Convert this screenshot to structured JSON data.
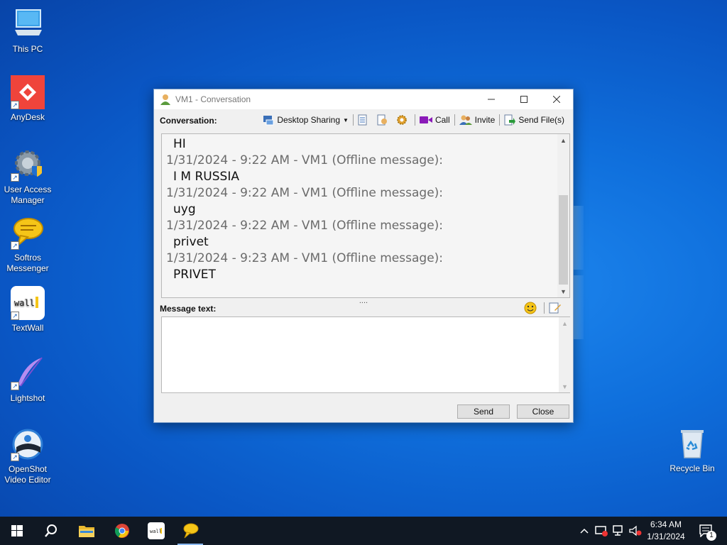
{
  "desktop": {
    "icons": [
      {
        "label": "This PC",
        "name": "this-pc-icon"
      },
      {
        "label": "AnyDesk",
        "name": "anydesk-icon"
      },
      {
        "label": "User Access Manager",
        "name": "user-access-manager-icon"
      },
      {
        "label": "Softros Messenger",
        "name": "softros-messenger-icon"
      },
      {
        "label": "TextWall",
        "name": "textwall-icon"
      },
      {
        "label": "Lightshot",
        "name": "lightshot-icon"
      },
      {
        "label": "OpenShot Video Editor",
        "name": "openshot-icon"
      },
      {
        "label": "Recycle Bin",
        "name": "recycle-bin-icon"
      }
    ]
  },
  "window": {
    "title": "VM1 - Conversation",
    "conversation_label": "Conversation:",
    "toolbar": {
      "desktop_sharing": "Desktop Sharing",
      "call": "Call",
      "invite": "Invite",
      "send_files": "Send File(s)"
    },
    "messages": [
      {
        "header": "",
        "text": "HI"
      },
      {
        "header": "1/31/2024 - 9:22 AM - VM1 (Offline message):",
        "text": "I M RUSSIA"
      },
      {
        "header": "1/31/2024 - 9:22 AM - VM1 (Offline message):",
        "text": "uyg"
      },
      {
        "header": "1/31/2024 - 9:22 AM - VM1 (Offline message):",
        "text": "privet"
      },
      {
        "header": "1/31/2024 - 9:23 AM - VM1 (Offline message):",
        "text": "PRIVET"
      }
    ],
    "splitter_grip": "....",
    "message_text_label": "Message text:",
    "message_input_value": "",
    "send_label": "Send",
    "close_label": "Close"
  },
  "taskbar": {
    "clock_time": "6:34 AM",
    "clock_date": "1/31/2024",
    "notification_count": "1"
  },
  "colors": {
    "desktop_blue": "#0f6fdc",
    "taskbar": "#101823",
    "window_bg": "#f0f0f0"
  }
}
